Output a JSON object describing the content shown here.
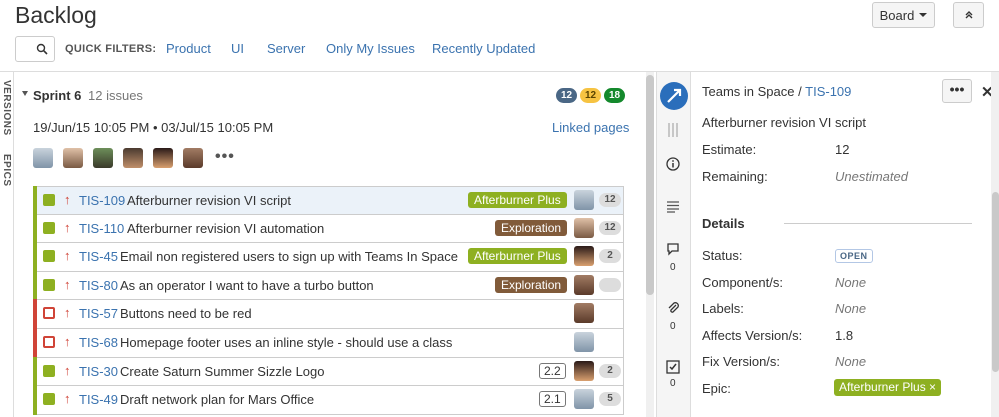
{
  "header": {
    "title": "Backlog",
    "board_label": "Board",
    "quick_filters_label": "QUICK FILTERS:",
    "quick_filters": [
      "Product",
      "UI",
      "Server",
      "Only My Issues",
      "Recently Updated"
    ]
  },
  "side_tabs": [
    "VERSIONS",
    "EPICS"
  ],
  "sprint": {
    "name": "Sprint 6",
    "issue_count": "12 issues",
    "dates": "19/Jun/15 10:05 PM • 03/Jul/15 10:05 PM",
    "linked_pages": "Linked pages",
    "status_counts": [
      {
        "value": "12",
        "color": "#4a6785"
      },
      {
        "value": "12",
        "color": "#f6c342"
      },
      {
        "value": "18",
        "color": "#14892c"
      }
    ],
    "more_assignees": "•••"
  },
  "issues": [
    {
      "key": "TIS-109",
      "summary": "Afterburner revision VI script",
      "type": "story",
      "epic": "Afterburner Plus",
      "epic_color": "#8eb021",
      "points": "12",
      "selected": true
    },
    {
      "key": "TIS-110",
      "summary": "Afterburner revision VI automation",
      "type": "story",
      "epic": "Exploration",
      "epic_color": "#815b3a",
      "points": "12",
      "selected": false
    },
    {
      "key": "TIS-45",
      "summary": "Email non registered users to sign up with Teams In Space",
      "type": "story",
      "epic": "Afterburner Plus",
      "epic_color": "#8eb021",
      "points": "2",
      "selected": false
    },
    {
      "key": "TIS-80",
      "summary": "As an operator I want to have a turbo button",
      "type": "story",
      "epic": "Exploration",
      "epic_color": "#815b3a",
      "points": "",
      "selected": false
    },
    {
      "key": "TIS-57",
      "summary": "Buttons need to be red",
      "type": "bug",
      "epic": "",
      "points": "",
      "selected": false
    },
    {
      "key": "TIS-68",
      "summary": "Homepage footer uses an inline style - should use a class",
      "type": "bug",
      "epic": "",
      "points": "",
      "selected": false
    },
    {
      "key": "TIS-30",
      "summary": "Create Saturn Summer Sizzle Logo",
      "type": "story",
      "epic": "",
      "estimate": "2.2",
      "points": "2",
      "selected": false
    },
    {
      "key": "TIS-49",
      "summary": "Draft network plan for Mars Office",
      "type": "story",
      "epic": "",
      "estimate": "2.1",
      "points": "5",
      "selected": false
    }
  ],
  "detail": {
    "project": "Teams in Space",
    "separator": "/",
    "key": "TIS-109",
    "more": "•••",
    "close": "✕",
    "title": "Afterburner revision VI script",
    "estimate_label": "Estimate:",
    "estimate_value": "12",
    "remaining_label": "Remaining:",
    "remaining_value": "Unestimated",
    "details_heading": "Details",
    "fields": [
      {
        "label": "Status:",
        "value": "OPEN"
      },
      {
        "label": "Component/s:",
        "value": "None"
      },
      {
        "label": "Labels:",
        "value": "None"
      },
      {
        "label": "Affects Version/s:",
        "value": "1.8"
      },
      {
        "label": "Fix Version/s:",
        "value": "None"
      },
      {
        "label": "Epic:",
        "value": "Afterburner Plus ×"
      }
    ],
    "tab_counts": [
      "0",
      "0",
      "0"
    ]
  }
}
